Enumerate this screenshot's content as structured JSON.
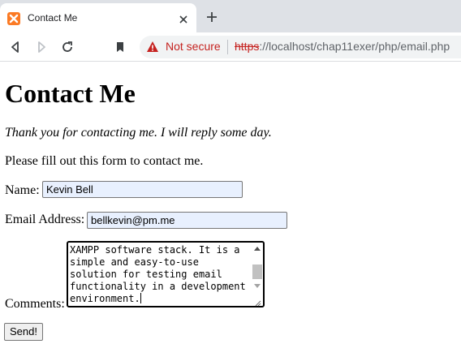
{
  "browser": {
    "tab": {
      "title": "Contact Me",
      "favicon": "xampp-logo-icon"
    },
    "security_label": "Not secure",
    "url": {
      "scheme": "https",
      "rest": "://localhost/chap11exer/php/email.php"
    }
  },
  "page": {
    "title": "Contact Me",
    "thanks": "Thank you for contacting me. I will reply some day.",
    "instructions": "Please fill out this form to contact me.",
    "form": {
      "name_label": "Name:",
      "name_value": "Kevin Bell",
      "email_label": "Email Address:",
      "email_value": "bellkevin@pm.me",
      "comments_label": "Comments:",
      "comments_visible_text": "XAMPP software stack. It is a\nsimple and easy-to-use\nsolution for testing email\nfunctionality in a development\nenvironment.",
      "send_label": "Send!"
    }
  },
  "colors": {
    "warning": "#c5221f",
    "autofill": "#e8f0fe",
    "xampp": "#fb7a24"
  }
}
